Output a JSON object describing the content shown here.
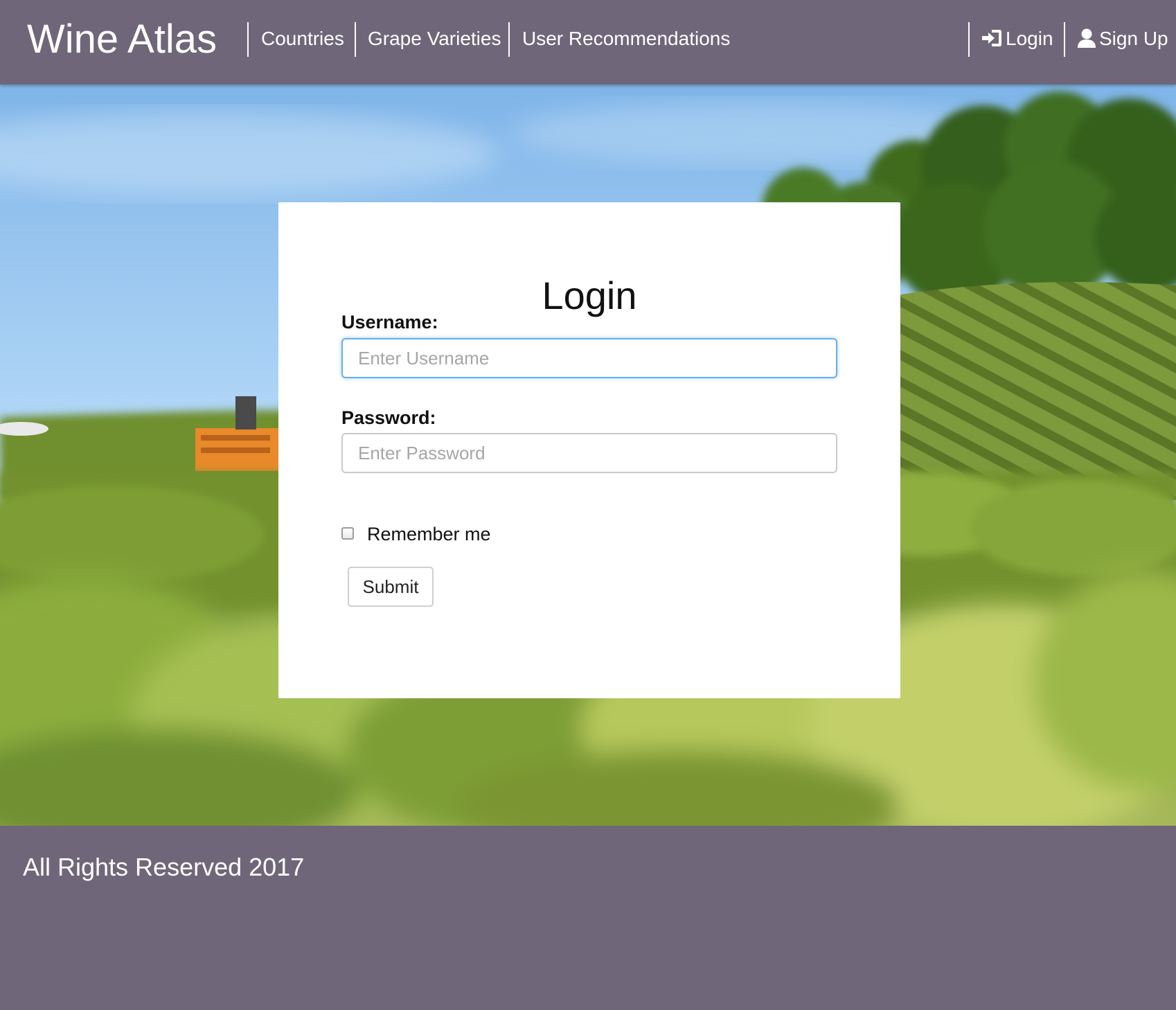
{
  "navbar": {
    "brand": "Wine Atlas",
    "links": [
      {
        "label": "Countries"
      },
      {
        "label": "Grape Varieties"
      },
      {
        "label": "User Recommendations"
      }
    ],
    "right_links": [
      {
        "label": "Login",
        "icon": "log-in-icon"
      },
      {
        "label": "Sign Up",
        "icon": "user-icon"
      }
    ]
  },
  "login_form": {
    "title": "Login",
    "username_label": "Username:",
    "username_placeholder": "Enter Username",
    "username_value": "",
    "password_label": "Password:",
    "password_placeholder": "Enter Password",
    "password_value": "",
    "remember_label": "Remember me",
    "remember_checked": false,
    "submit_label": "Submit"
  },
  "footer": {
    "text": "All Rights Reserved 2017"
  },
  "colors": {
    "navbar_bg": "#6f6779",
    "footer_bg": "#6f6779",
    "input_focus": "#66afe9",
    "card_bg": "#ffffff"
  }
}
